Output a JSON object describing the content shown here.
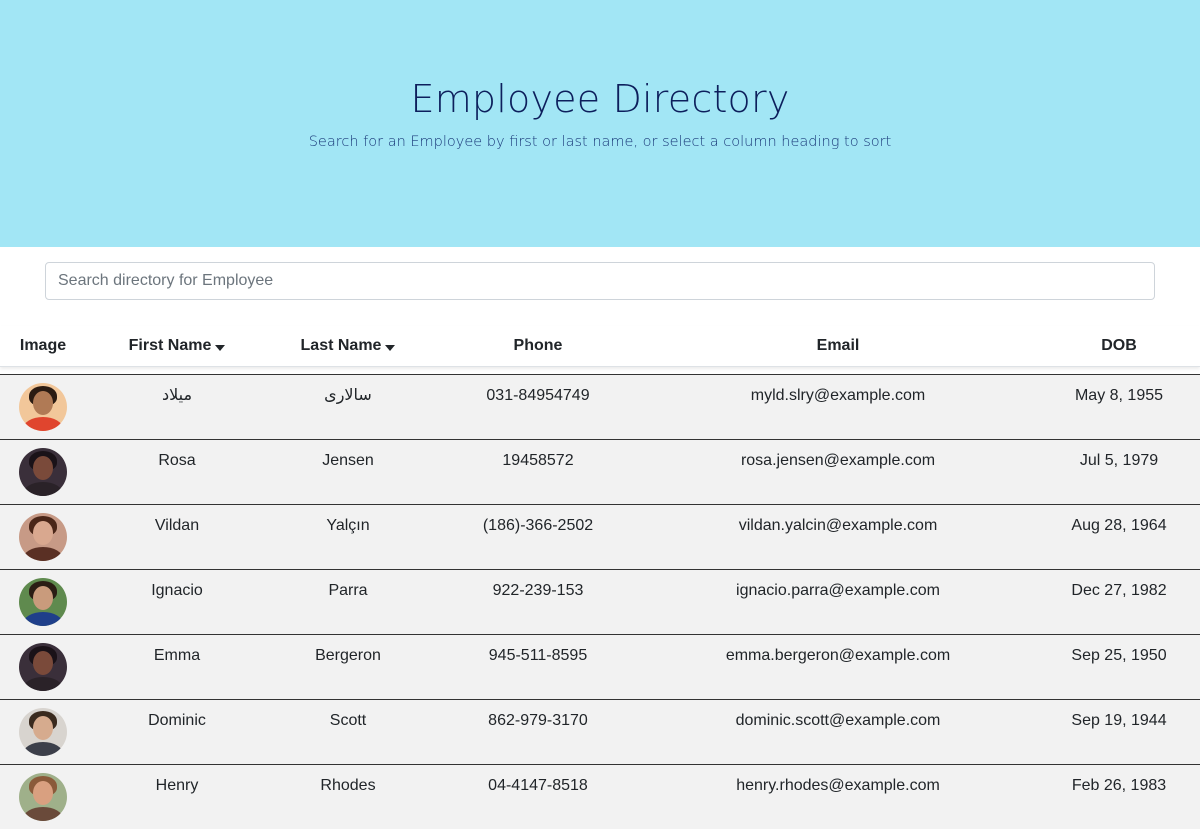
{
  "header": {
    "title": "Employee Directory",
    "subtitle": "Search for an Employee by first or last name, or select a column heading to sort"
  },
  "search": {
    "placeholder": "Search directory for Employee",
    "value": ""
  },
  "table": {
    "columns": {
      "image": "Image",
      "first": "First Name",
      "last": "Last Name",
      "phone": "Phone",
      "email": "Email",
      "dob": "DOB"
    },
    "rows": [
      {
        "first": "میلاد",
        "last": "سالاری",
        "phone": "031-84954749",
        "email": "myld.slry@example.com",
        "dob": "May 8, 1955"
      },
      {
        "first": "Rosa",
        "last": "Jensen",
        "phone": "19458572",
        "email": "rosa.jensen@example.com",
        "dob": "Jul 5, 1979"
      },
      {
        "first": "Vildan",
        "last": "Yalçın",
        "phone": "(186)-366-2502",
        "email": "vildan.yalcin@example.com",
        "dob": "Aug 28, 1964"
      },
      {
        "first": "Ignacio",
        "last": "Parra",
        "phone": "922-239-153",
        "email": "ignacio.parra@example.com",
        "dob": "Dec 27, 1982"
      },
      {
        "first": "Emma",
        "last": "Bergeron",
        "phone": "945-511-8595",
        "email": "emma.bergeron@example.com",
        "dob": "Sep 25, 1950"
      },
      {
        "first": "Dominic",
        "last": "Scott",
        "phone": "862-979-3170",
        "email": "dominic.scott@example.com",
        "dob": "Sep 19, 1944"
      },
      {
        "first": "Henry",
        "last": "Rhodes",
        "phone": "04-4147-8518",
        "email": "henry.rhodes@example.com",
        "dob": "Feb 26, 1983"
      }
    ]
  },
  "colors": {
    "hero_bg": "#a2e6f5",
    "hero_text": "#0d1f5c",
    "row_bg": "#f2f2f2",
    "row_border": "#333333"
  }
}
